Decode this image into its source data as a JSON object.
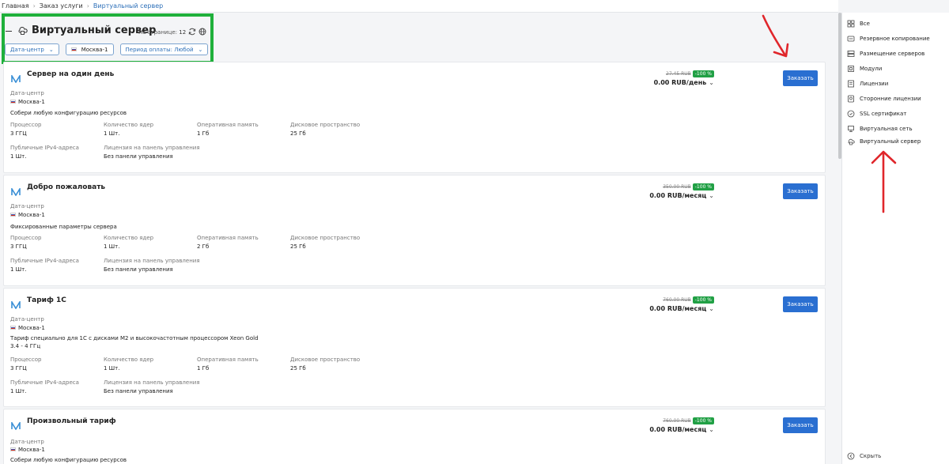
{
  "breadcrumb": {
    "home": "Главная",
    "order": "Заказ услуги",
    "current": "Виртуальный сервер"
  },
  "header": {
    "title": "Виртуальный сервер",
    "per_page_label": "На странице:",
    "per_page_value": "12",
    "filters": {
      "datacenter": "Дата-центр",
      "location": "Москва-1",
      "period": "Период оплаты: Любой"
    }
  },
  "labels": {
    "datacenter": "Дата-центр",
    "cpu": "Процессор",
    "cores": "Количество ядер",
    "ram": "Оперативная память",
    "disk": "Дисковое пространство",
    "ipv4": "Публичные IPv4-адреса",
    "license": "Лицензия на панель управления",
    "order_button": "Заказать"
  },
  "cards": [
    {
      "title": "Сервер на один день",
      "location": "Москва-1",
      "description": "Собери любую конфигурацию ресурсов",
      "cpu": "3 ГГЦ",
      "cores": "1 Шт.",
      "ram": "1 Гб",
      "disk": "25 Гб",
      "ipv4": "1 Шт.",
      "license": "Без панели управления",
      "old_price": "27.45 RUB",
      "discount": "-100 %",
      "new_price": "0.00 RUB/день"
    },
    {
      "title": "Добро пожаловать",
      "location": "Москва-1",
      "description": "Фиксированные параметры сервера",
      "cpu": "3 ГГЦ",
      "cores": "1 Шт.",
      "ram": "2 Гб",
      "disk": "25 Гб",
      "ipv4": "1 Шт.",
      "license": "Без панели управления",
      "old_price": "350.00 RUB",
      "discount": "-100 %",
      "new_price": "0.00 RUB/месяц"
    },
    {
      "title": "Тариф 1С",
      "location": "Москва-1",
      "description": "Тариф специально для 1С с дисками M2 и высокочастотным процессором Xeon Gold 3.4 - 4 ГГц",
      "cpu": "3 ГГЦ",
      "cores": "1 Шт.",
      "ram": "1 Гб",
      "disk": "25 Гб",
      "ipv4": "1 Шт.",
      "license": "Без панели управления",
      "old_price": "760.00 RUB",
      "discount": "-100 %",
      "new_price": "0.00 RUB/месяц"
    },
    {
      "title": "Произвольный тариф",
      "location": "Москва-1",
      "description": "Собери любую конфигурацию ресурсов",
      "old_price": "760.00 RUB",
      "discount": "-100 %",
      "new_price": "0.00 RUB/месяц"
    }
  ],
  "sidebar": {
    "items": [
      {
        "label": "Все",
        "icon": "grid-icon"
      },
      {
        "label": "Резервное копирование",
        "icon": "backup-icon"
      },
      {
        "label": "Размещение серверов",
        "icon": "server-icon"
      },
      {
        "label": "Модули",
        "icon": "module-icon"
      },
      {
        "label": "Лицензии",
        "icon": "license-icon"
      },
      {
        "label": "Сторонние лицензии",
        "icon": "third-party-license-icon"
      },
      {
        "label": "SSL сертификат",
        "icon": "ssl-icon"
      },
      {
        "label": "Виртуальная сеть",
        "icon": "network-icon"
      },
      {
        "label": "Виртуальный сервер",
        "icon": "cloud-server-icon"
      }
    ],
    "hide_label": "Скрыть"
  },
  "colors": {
    "accent": "#2a6fd1",
    "highlight": "#1fb03b",
    "badge": "#21a045",
    "annotation": "#e0262b"
  }
}
